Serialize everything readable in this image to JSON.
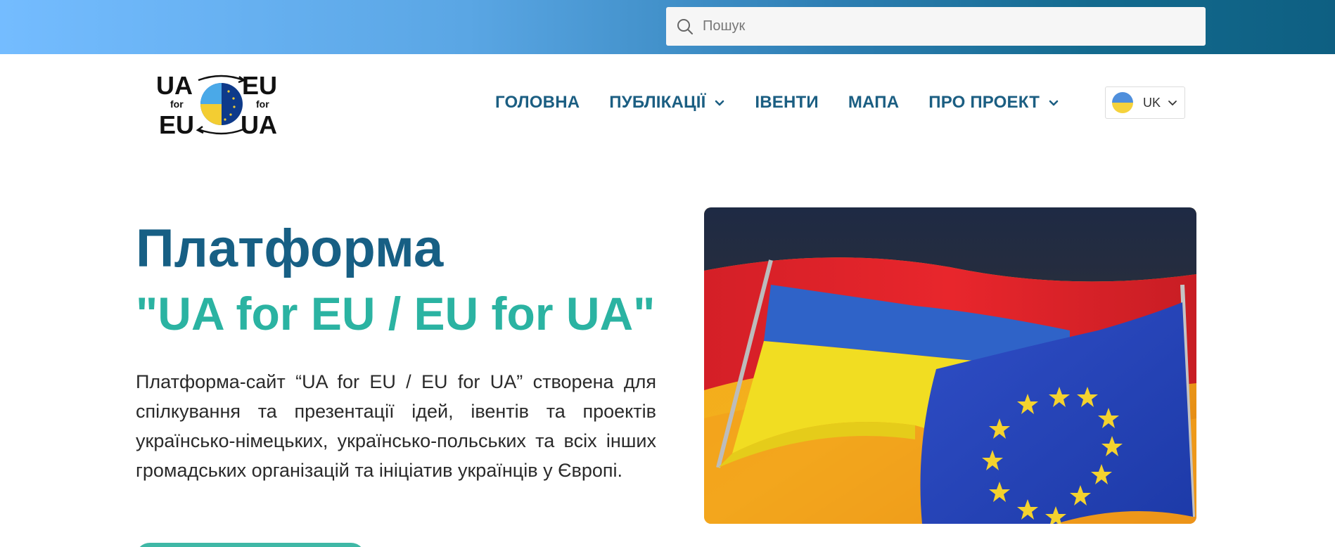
{
  "search": {
    "placeholder": "Пошук"
  },
  "logo": {
    "text_top_left": "UA",
    "text_top_right": "EU",
    "text_bottom_left": "EU",
    "text_bottom_right": "UA",
    "for_left": "for",
    "for_right": "for"
  },
  "nav": {
    "items": [
      {
        "label": "ГОЛОВНА",
        "has_dropdown": false
      },
      {
        "label": "ПУБЛІКАЦІЇ",
        "has_dropdown": true
      },
      {
        "label": "ІВЕНТИ",
        "has_dropdown": false
      },
      {
        "label": "МАПА",
        "has_dropdown": false
      },
      {
        "label": "ПРО ПРОЕКТ",
        "has_dropdown": true
      }
    ]
  },
  "language": {
    "selected": "UK",
    "flag": "ukraine-flag-icon"
  },
  "hero": {
    "title": "Платформа",
    "subtitle": "\"UA for EU / EU for UA\"",
    "description": "Платформа-сайт “UA for EU / EU for UA” створена для спілкування та презентації ідей, івентів та проектів українсько-німецьких, українсько-польських та всіх інших громадських організацій та ініціатив українців у Європі.",
    "image": "ukraine-germany-eu-flags-image"
  },
  "colors": {
    "primary_blue": "#175f84",
    "accent_teal": "#2bb3a2",
    "topbar_start": "#74bcff",
    "topbar_end": "#0e5f82"
  }
}
